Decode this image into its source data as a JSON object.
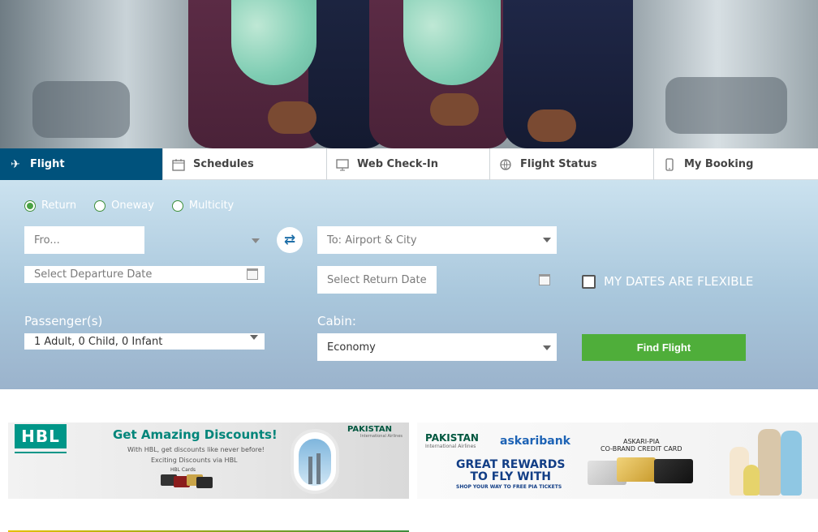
{
  "tabs": [
    {
      "label": "Flight",
      "icon": "plane-icon",
      "active": true
    },
    {
      "label": "Schedules",
      "icon": "calendar-icon",
      "active": false
    },
    {
      "label": "Web Check-In",
      "icon": "monitor-icon",
      "active": false
    },
    {
      "label": "Flight Status",
      "icon": "globe-plane-icon",
      "active": false
    },
    {
      "label": "My Booking",
      "icon": "phone-icon",
      "active": false
    }
  ],
  "trip_types": [
    {
      "label": "Return",
      "selected": true
    },
    {
      "label": "Oneway",
      "selected": false
    },
    {
      "label": "Multicity",
      "selected": false
    }
  ],
  "from": {
    "placeholder": "Fro..."
  },
  "to": {
    "placeholder": "To: Airport & City"
  },
  "departure_date": {
    "placeholder": "Select Departure Date"
  },
  "return_date": {
    "placeholder": "Select Return Date"
  },
  "flexible_label": "MY DATES ARE FLEXIBLE",
  "passengers": {
    "label": "Passenger(s)",
    "value": "1 Adult, 0 Child, 0 Infant"
  },
  "cabin": {
    "label": "Cabin:",
    "value": "Economy"
  },
  "find_button": "Find Flight",
  "colors": {
    "accent": "#00527c",
    "button": "#4fae3a",
    "hbl": "#009688"
  },
  "banner_hbl": {
    "logo": "HBL",
    "headline": "Get Amazing Discounts!",
    "line1": "With HBL, get discounts like never before!",
    "line2": "Exciting Discounts via HBL",
    "cards": "HBL Cards",
    "airline": "PAKISTAN",
    "airline_sub": "International Airlines"
  },
  "banner_askari": {
    "airline": "PAKISTAN",
    "airline_sub": "International Airlines",
    "bank": "askaribank",
    "headline_1": "GREAT REWARDS",
    "headline_2": "TO FLY WITH",
    "tagline": "SHOP YOUR WAY TO FREE PIA TICKETS",
    "card_title_1": "ASKARI-PIA",
    "card_title_2": "CO-BRAND CREDIT CARD"
  }
}
